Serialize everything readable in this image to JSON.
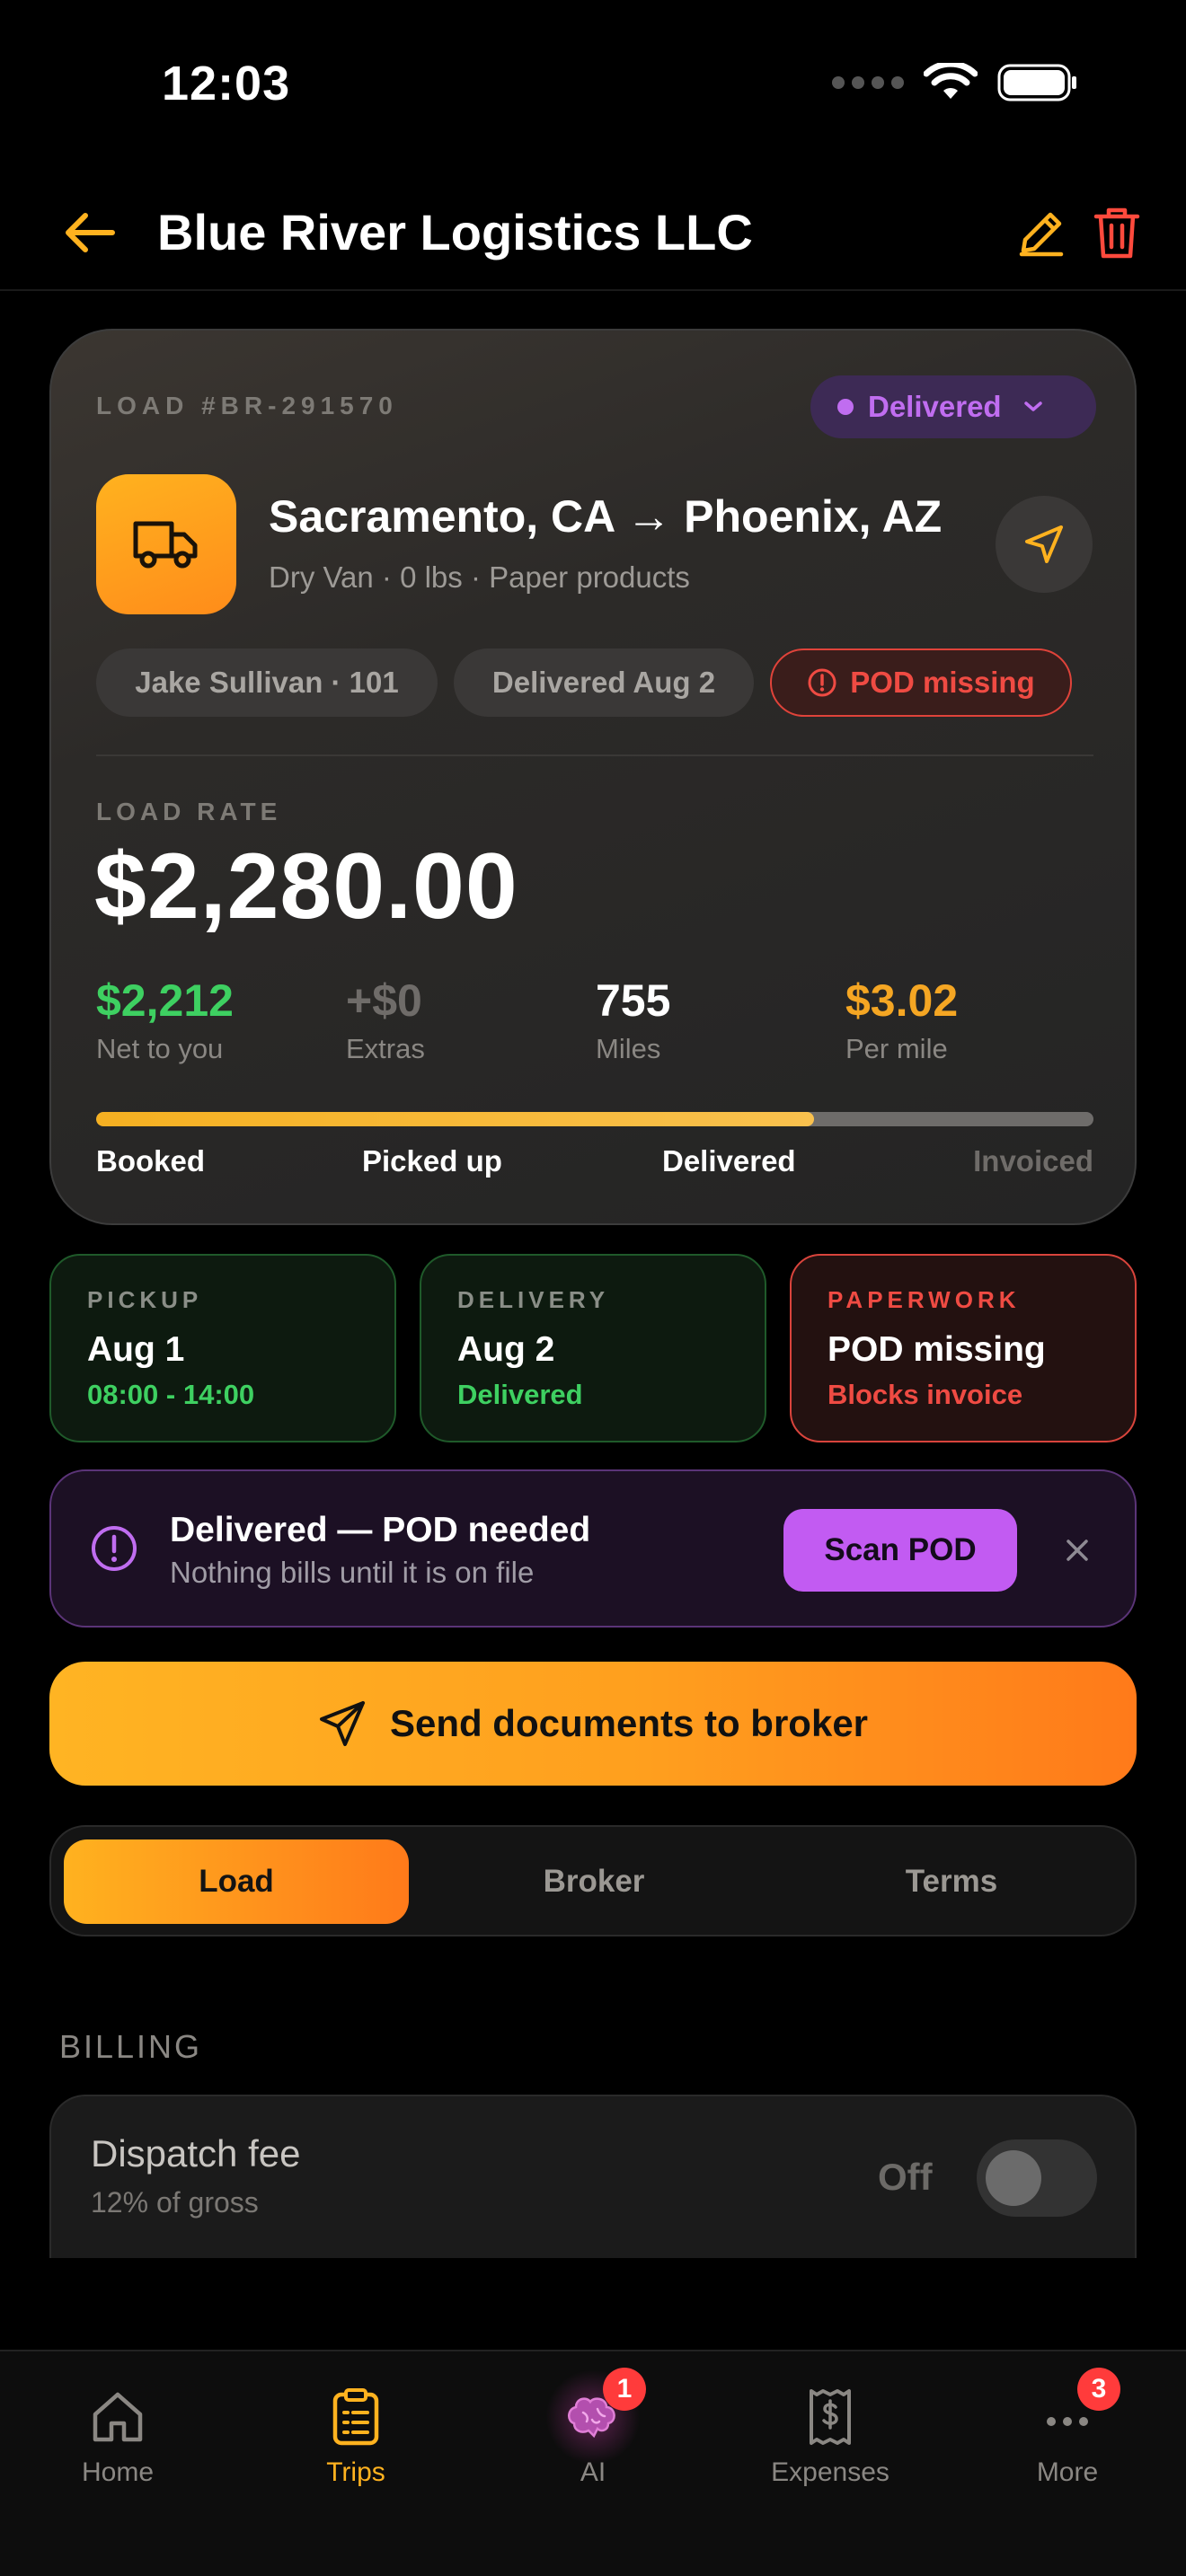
{
  "status_bar": {
    "time": "12:03"
  },
  "header": {
    "title": "Blue River Logistics LLC"
  },
  "load": {
    "number": "LOAD #BR-291570",
    "status": "Delivered",
    "route": "Sacramento, CA → Phoenix, AZ",
    "details": "Dry Van · 0 lbs · Paper products",
    "chips": {
      "driver": "Jake Sullivan · 101",
      "delivered": "Delivered Aug 2",
      "pod": "POD missing"
    },
    "rate_label": "LOAD RATE",
    "rate": "$2,280.00",
    "stats": [
      {
        "value": "$2,212",
        "label": "Net to you",
        "color": "#3ed061"
      },
      {
        "value": "+$0",
        "label": "Extras",
        "color": "#6f6c69"
      },
      {
        "value": "755",
        "label": "Miles",
        "color": "#ffffff"
      },
      {
        "value": "$3.02",
        "label": "Per mile",
        "color": "#f5a623"
      }
    ],
    "progress": {
      "fraction": 0.72,
      "steps": [
        {
          "label": "Booked",
          "done": true
        },
        {
          "label": "Picked up",
          "done": true
        },
        {
          "label": "Delivered",
          "done": true
        },
        {
          "label": "Invoiced",
          "done": false
        }
      ]
    }
  },
  "tiles": {
    "pickup": {
      "key": "PICKUP",
      "title": "Aug 1",
      "sub": "08:00 - 14:00"
    },
    "delivery": {
      "key": "DELIVERY",
      "title": "Aug 2",
      "sub": "Delivered"
    },
    "paperwork": {
      "key": "PAPERWORK",
      "title": "POD missing",
      "sub": "Blocks invoice"
    }
  },
  "alert": {
    "title": "Delivered — POD needed",
    "subtitle": "Nothing bills until it is on file",
    "action": "Scan POD"
  },
  "send_button": "Send documents to broker",
  "tabs": [
    {
      "label": "Load",
      "active": true
    },
    {
      "label": "Broker",
      "active": false
    },
    {
      "label": "Terms",
      "active": false
    }
  ],
  "billing": {
    "section": "BILLING",
    "title": "Dispatch fee",
    "subtitle": "12% of gross",
    "toggle_state": "Off"
  },
  "bottom_nav": [
    {
      "label": "Home",
      "icon": "home-icon",
      "active": false
    },
    {
      "label": "Trips",
      "icon": "clipboard-icon",
      "active": true
    },
    {
      "label": "AI",
      "icon": "brain-icon",
      "active": false,
      "badge": "1"
    },
    {
      "label": "Expenses",
      "icon": "receipt-icon",
      "active": false
    },
    {
      "label": "More",
      "icon": "more-icon",
      "active": false,
      "badge": "3"
    }
  ],
  "colors": {
    "accent": "#ffb21f",
    "danger": "#ef4b43",
    "success": "#3ed061",
    "purple": "#c06df0"
  }
}
